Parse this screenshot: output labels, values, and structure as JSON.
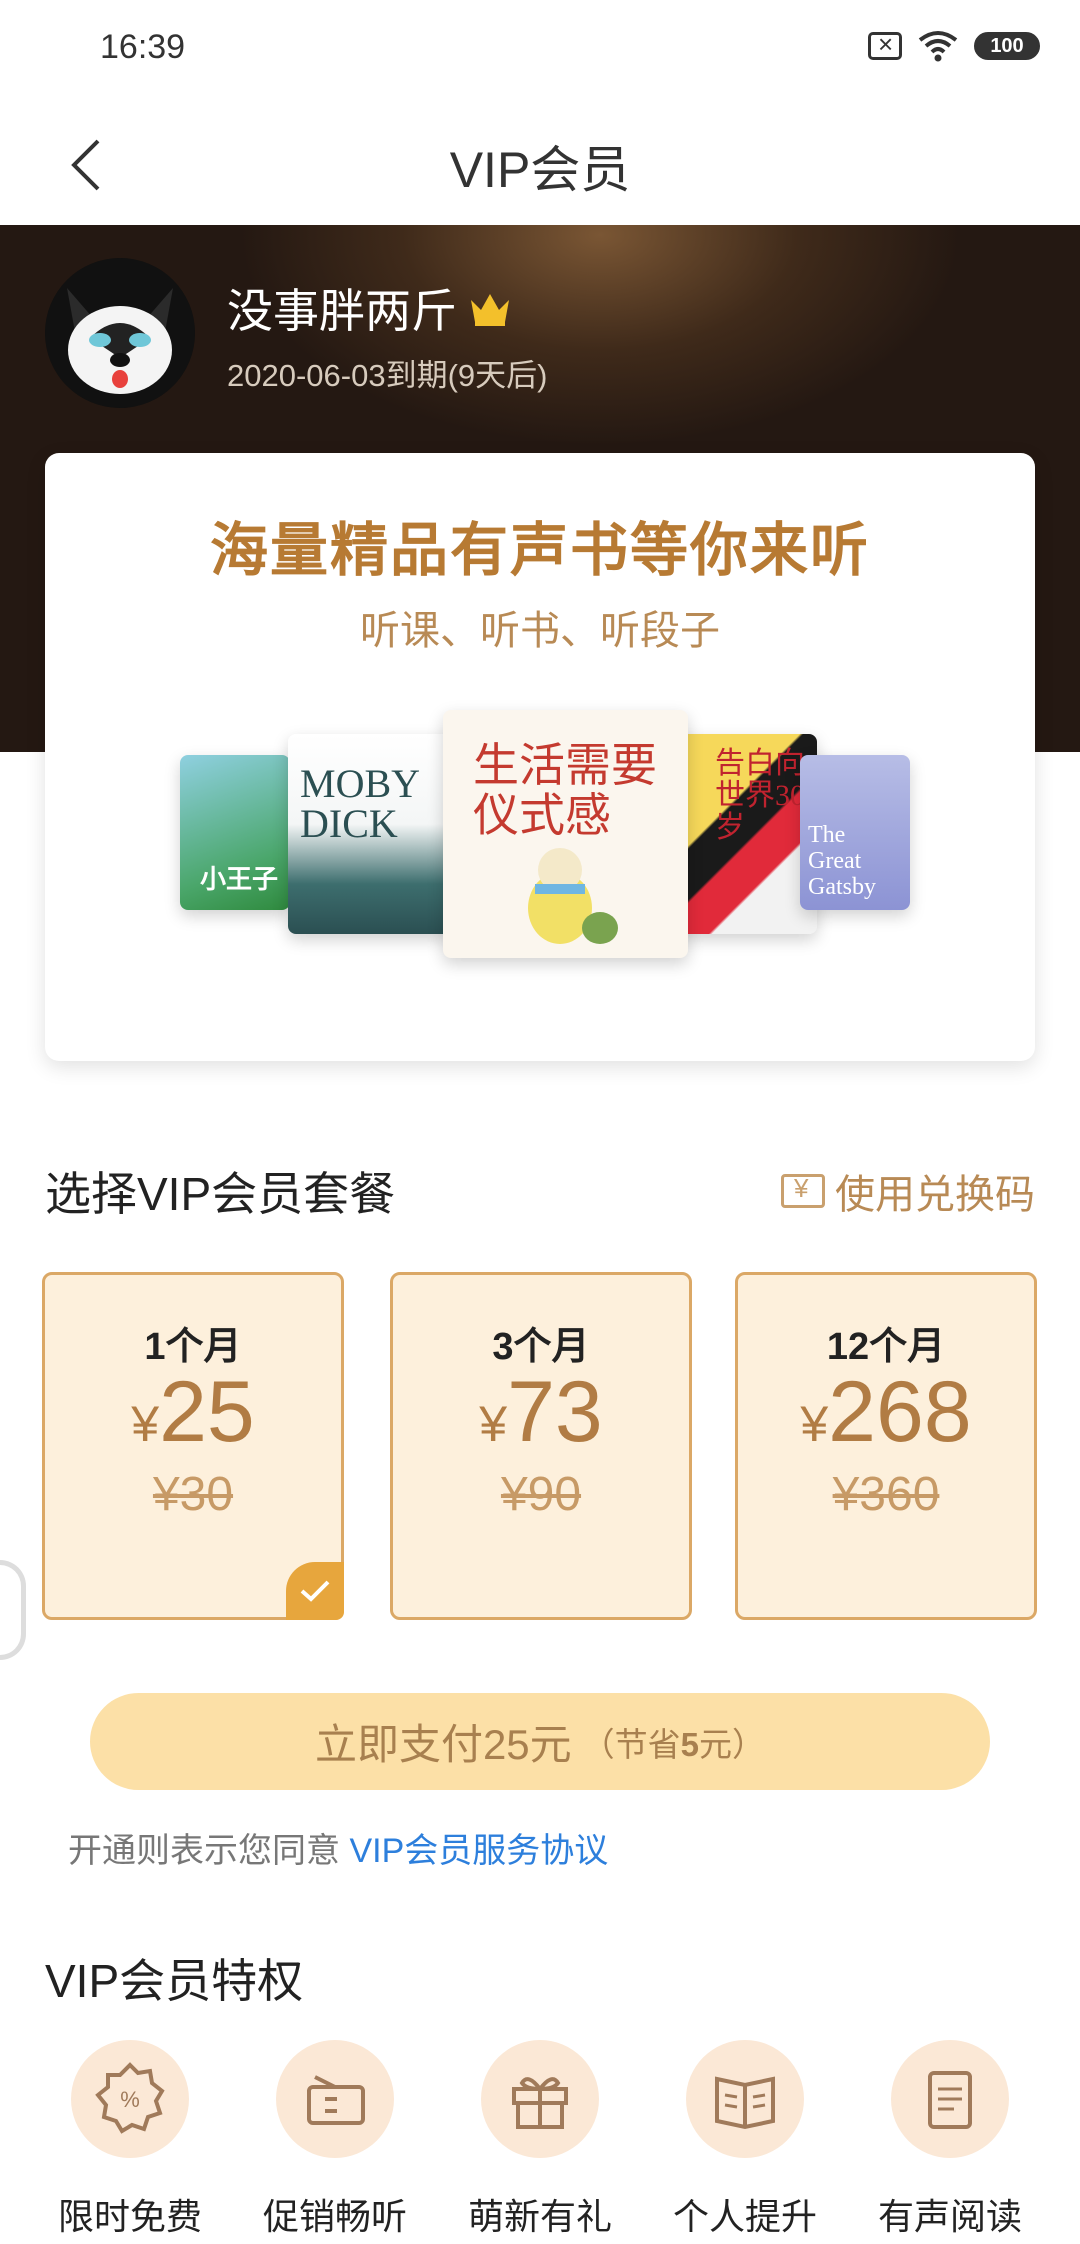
{
  "status_bar": {
    "time": "16:39",
    "battery": "100"
  },
  "header": {
    "title": "VIP会员"
  },
  "user": {
    "name": "没事胖两斤",
    "expiry": "2020-06-03到期(9天后)"
  },
  "banner": {
    "title": "海量精品有声书等你来听",
    "subtitle": "听课、听书、听段子",
    "books": [
      {
        "title": "小王子"
      },
      {
        "title": "MOBY DICK"
      },
      {
        "title": "生活需要仪式感"
      },
      {
        "title": "告白向世界30岁"
      },
      {
        "title": "The Great Gatsby"
      }
    ]
  },
  "plans_section": {
    "title": "选择VIP会员套餐",
    "redeem_label": "使用兑换码"
  },
  "plans": [
    {
      "duration": "1个月",
      "currency": "¥",
      "price": "25",
      "original": "¥30",
      "selected": true
    },
    {
      "duration": "3个月",
      "currency": "¥",
      "price": "73",
      "original": "¥90",
      "selected": false
    },
    {
      "duration": "12个月",
      "currency": "¥",
      "price": "268",
      "original": "¥360",
      "selected": false
    }
  ],
  "pay": {
    "label": "立即支付25元",
    "extra_open": "（节省",
    "extra_amount": "5",
    "extra_close": "元）"
  },
  "agreement": {
    "text": "开通则表示您同意 ",
    "link": "VIP会员服务协议"
  },
  "perks_section": {
    "title": "VIP会员特权"
  },
  "perks": [
    {
      "label": "限时免费",
      "icon": "discount-badge-icon"
    },
    {
      "label": "促销畅听",
      "icon": "coupon-icon"
    },
    {
      "label": "萌新有礼",
      "icon": "gift-icon"
    },
    {
      "label": "个人提升",
      "icon": "book-open-icon"
    },
    {
      "label": "有声阅读",
      "icon": "document-icon"
    }
  ],
  "colors": {
    "accent": "#b17c44",
    "card_bg": "#fdf0dc",
    "pay_bg": "#fce0a7",
    "link": "#2d7fdc"
  }
}
